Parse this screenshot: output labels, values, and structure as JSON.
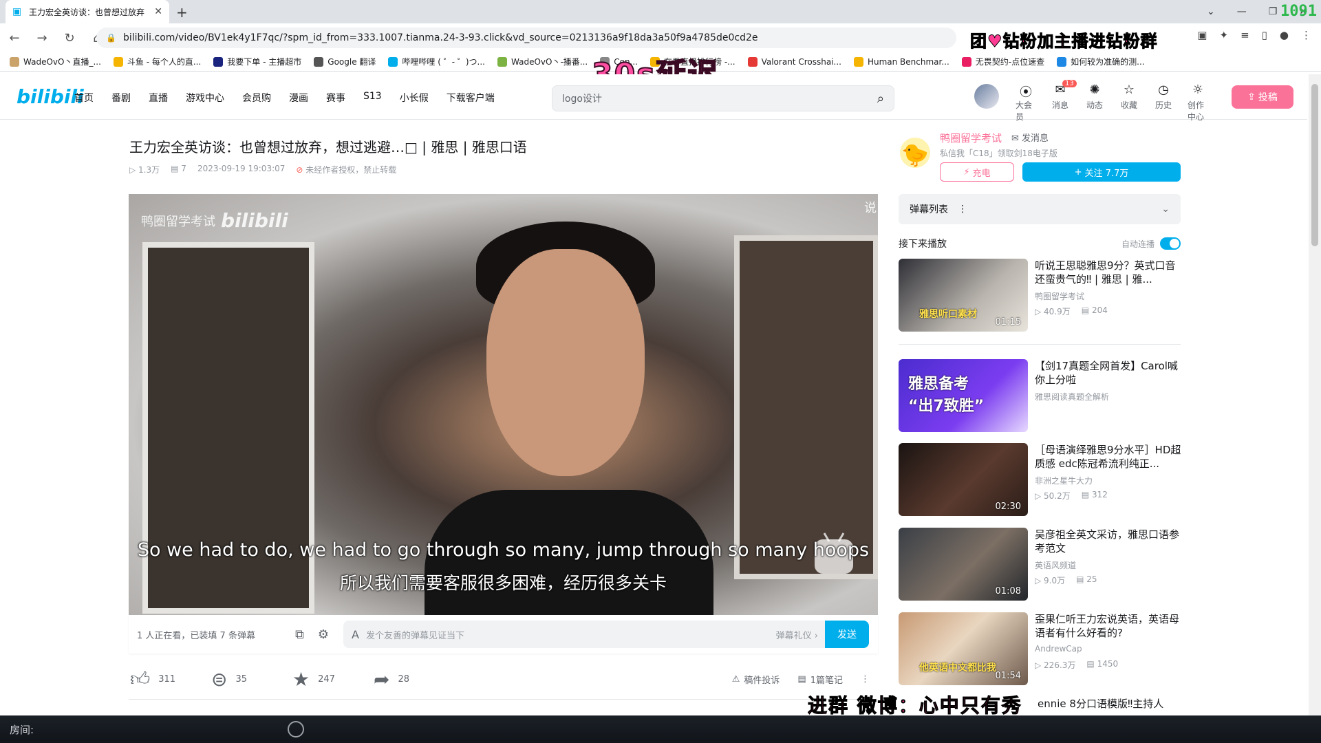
{
  "browser": {
    "tab_title": "王力宏全英访谈：也曾想过放弃",
    "url": "bilibili.com/video/BV1ek4y1F7qc/?spm_id_from=333.1007.tianma.24-3-93.click&vd_source=0213136a9f18da3a50f9a4785de0cd2e",
    "fps_counter": "1091",
    "bookmarks": [
      {
        "label": "WadeOvO丶直播_...",
        "color": "#c9a36a"
      },
      {
        "label": "斗鱼 - 每个人的直...",
        "color": "#f4b400"
      },
      {
        "label": "我要下单 - 主播超市",
        "color": "#1a237e"
      },
      {
        "label": "Google 翻译",
        "color": "#555555"
      },
      {
        "label": "哔哩哔哩 ( ゜- ゜)つ...",
        "color": "#00aeec"
      },
      {
        "label": "WadeOvO丶-播番...",
        "color": "#7cb342"
      },
      {
        "label": "Con...",
        "color": "#888888"
      },
      {
        "label": "在看直播排行榜 -...",
        "color": "#f4b400"
      },
      {
        "label": "Valorant Crosshai...",
        "color": "#e53935"
      },
      {
        "label": "Human Benchmar...",
        "color": "#f4b400"
      },
      {
        "label": "无畏契约-点位速查",
        "color": "#e91e63"
      },
      {
        "label": "如何较为准确的测...",
        "color": "#1e88e5"
      }
    ]
  },
  "overlays": {
    "top_danmaku": "团♥钻粉加主播进钻粉群",
    "delay": "30s延迟",
    "bottom_danmaku": "进群 微博：心中只有秀",
    "obs_room_label": "房间:"
  },
  "header": {
    "logo": "bilibili",
    "nav": [
      "首页",
      "番剧",
      "直播",
      "游戏中心",
      "会员购",
      "漫画",
      "赛事",
      "S13",
      "小长假",
      "下载客户端"
    ],
    "search_placeholder": "logo设计",
    "right_items": [
      {
        "label": "大会员",
        "icon": "vip-icon"
      },
      {
        "label": "消息",
        "icon": "message-icon",
        "badge": "13"
      },
      {
        "label": "动态",
        "icon": "dynamic-icon"
      },
      {
        "label": "收藏",
        "icon": "star-icon"
      },
      {
        "label": "历史",
        "icon": "clock-icon"
      },
      {
        "label": "创作中心",
        "icon": "lightbulb-icon"
      }
    ],
    "upload_label": "投稿"
  },
  "video": {
    "title": "王力宏全英访谈：也曾想过放弃，想过逃避…□ | 雅思 | 雅思口语",
    "views": "1.3万",
    "danmaku_count": "7",
    "date": "2023-09-19 19:03:07",
    "copyright": "未经作者授权，禁止转载",
    "watermark_text": "鸭圈留学考试",
    "watermark_logo": "bilibili",
    "watermark_tr": "说",
    "subtitle_en": "So we had to do, we had to go through so many, jump through so many hoops",
    "subtitle_zh": "所以我们需要客服很多困难，经历很多关卡"
  },
  "danmaku_bar": {
    "watching": "1 人正在看，已装填 7 条弹幕",
    "input_placeholder": "发个友善的弹幕见证当下",
    "etiquette": "弹幕礼仪 ›",
    "send": "发送"
  },
  "actions": {
    "like": "311",
    "coin": "35",
    "favorite": "247",
    "share": "28",
    "report": "稿件投诉",
    "notes": "1篇笔记"
  },
  "uploader": {
    "name": "鸭圈留学考试",
    "message": "发消息",
    "desc": "私信我「C18」领取剑18电子版",
    "charge": "充电",
    "follow": "关注 7.7万"
  },
  "sidebar": {
    "danmaku_list": "弹幕列表",
    "next_play": "接下来播放",
    "autoplay": "自动连播",
    "recommendations": [
      {
        "title": "听说王思聪雅思9分？英式口音还蛮贵气的‼ | 雅思 | 雅...",
        "author": "鸭圈留学考试",
        "views": "40.9万",
        "danmaku": "204",
        "duration": "01:15",
        "thumb_label": "雅思听口素材",
        "bg": "linear-gradient(135deg,#2e2f36,#b9b4ad 60%,#e8e4dc)"
      },
      {
        "title": "【剑17真题全网首发】Carol喊你上分啦",
        "author": "雅思阅读真题全解析",
        "views": "",
        "danmaku": "",
        "duration": "",
        "thumb_label": "雅思备考\n“出7致胜”",
        "bg": "linear-gradient(135deg,#4b2ccf,#7b3df0 60%,#e7d9ff)"
      },
      {
        "title": "［母语演绎雅思9分水平］HD超质感 edc陈冠希流利纯正...",
        "author": "非洲之星牛大力",
        "views": "50.2万",
        "danmaku": "312",
        "duration": "02:30",
        "thumb_label": "",
        "bg": "linear-gradient(135deg,#1b1412,#5a3a2e 55%,#2a1d18)"
      },
      {
        "title": "吴彦祖全英文采访，雅思口语参考范文",
        "author": "英语风频道",
        "views": "9.0万",
        "danmaku": "25",
        "duration": "01:08",
        "thumb_label": "",
        "bg": "linear-gradient(135deg,#3a3f46,#7c6f64 55%,#22262b)"
      },
      {
        "title": "歪果仁听王力宏说英语，英语母语者有什么好看的?",
        "author": "AndrewCap",
        "views": "226.3万",
        "danmaku": "1450",
        "duration": "01:54",
        "thumb_label": "他英语中文都比我",
        "bg": "linear-gradient(135deg,#c89a74,#e9d6c0 45%,#6d5a4c)"
      }
    ],
    "partial_title": "ennie 8分口语模版‼主持人"
  }
}
